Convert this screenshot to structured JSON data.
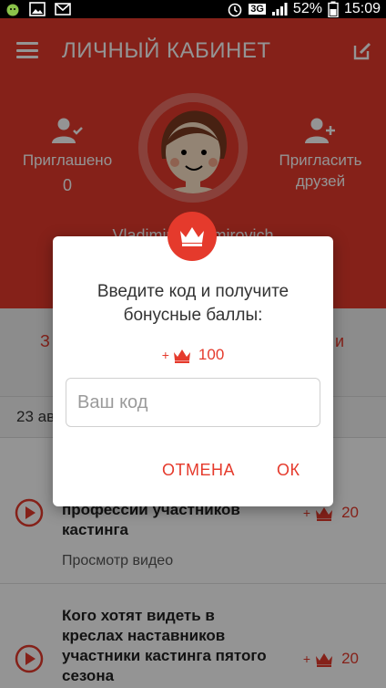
{
  "status_bar": {
    "network": "3G",
    "battery": "52%",
    "time": "15:09"
  },
  "app_bar": {
    "title": "ЛИЧНЫЙ КАБИНЕТ"
  },
  "profile": {
    "invited_label": "Приглашено",
    "invited_count": "0",
    "invite_label_line1": "Пригласить",
    "invite_label_line2": "друзей",
    "name": "Vladimir Vladimirovich"
  },
  "tabs": {
    "left_peek": "З",
    "right_peek": "и"
  },
  "feed": {
    "date": "23 ав",
    "items": [
      {
        "title_line1": "профессии участников",
        "title_line2": "кастинга",
        "subtitle": "Просмотр видео",
        "points_prefix": "+",
        "points": "20"
      },
      {
        "title_line1": "Кого хотят видеть в",
        "title_line2": "креслах наставников",
        "title_line3": "участники кастинга пятого",
        "title_line4": "сезона",
        "points_prefix": "+",
        "points": "20"
      }
    ]
  },
  "dialog": {
    "title_line1": "Введите код и получите",
    "title_line2": "бонусные баллы:",
    "reward_prefix": "+",
    "reward_value": "100",
    "input_placeholder": "Ваш код",
    "input_value": "",
    "cancel_label": "ОТМЕНА",
    "ok_label": "ОК"
  },
  "colors": {
    "accent": "#e53a2c",
    "overlay": "#000000"
  }
}
